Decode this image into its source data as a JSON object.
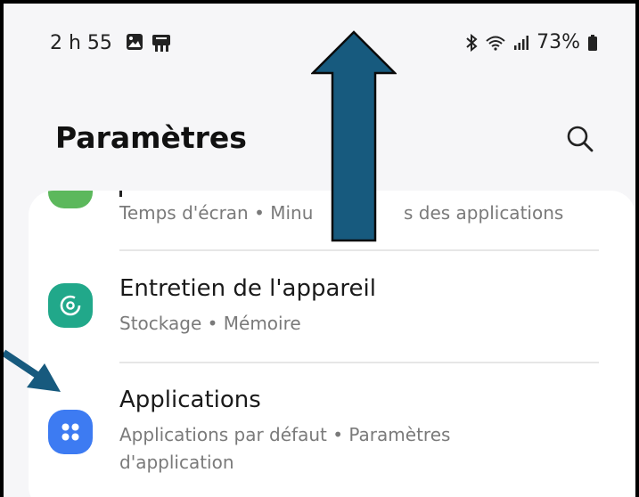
{
  "status_bar": {
    "time": "2 h 55",
    "battery_percent": "73%"
  },
  "header": {
    "title": "Paramètres"
  },
  "list": {
    "partial_item": {
      "subtitle_left": "Temps d'écran • Minu",
      "subtitle_right": "s des applications",
      "icon_color": "#5cb85c"
    },
    "items": [
      {
        "title": "Entretien de l'appareil",
        "subtitle": "Stockage • Mémoire",
        "icon": "device-care-icon",
        "icon_color": "#21a88a"
      },
      {
        "title": "Applications",
        "subtitle": "Applications par défaut • Paramètres d'application",
        "icon": "apps-grid-icon",
        "icon_color": "#3d7bf2"
      }
    ]
  },
  "annotation_colors": {
    "arrow_fill": "#175a7e",
    "arrow_outline": "#0a0a0a"
  }
}
